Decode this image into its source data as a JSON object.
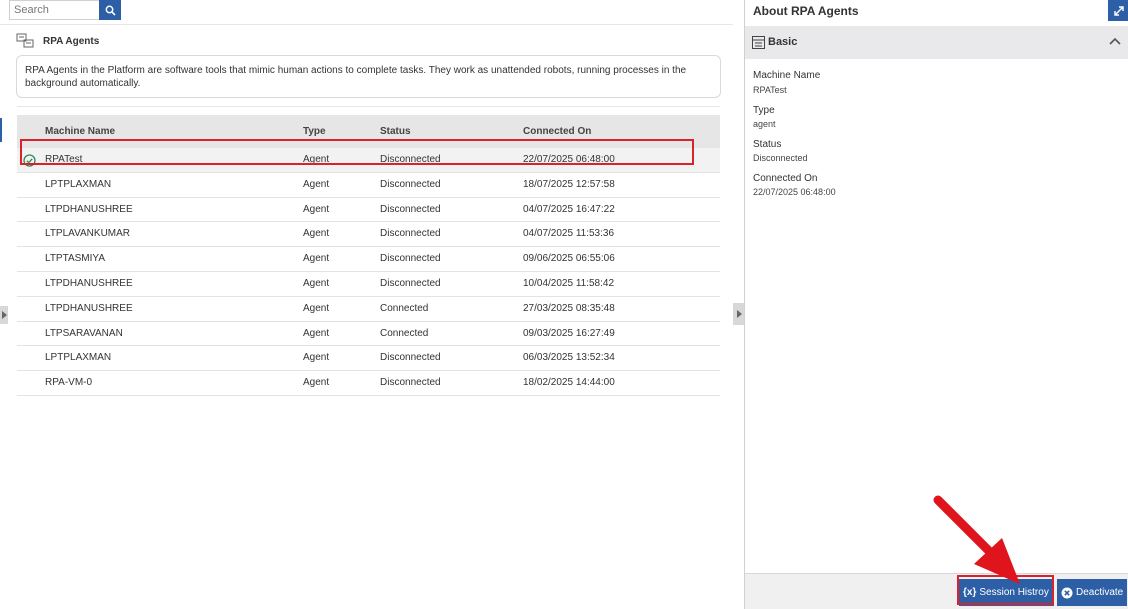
{
  "search": {
    "placeholder": "Search"
  },
  "section": {
    "title": "RPA Agents"
  },
  "description": "RPA Agents in the Platform are software tools that mimic human actions to complete tasks. They work as unattended robots, running processes in the background automatically.",
  "table": {
    "columns": [
      "Machine Name",
      "Type",
      "Status",
      "Connected On"
    ],
    "rows": [
      {
        "name": "RPATest",
        "type": "Agent",
        "status": "Disconnected",
        "connected_on": "22/07/2025 06:48:00"
      },
      {
        "name": "LPTPLAXMAN",
        "type": "Agent",
        "status": "Disconnected",
        "connected_on": "18/07/2025 12:57:58"
      },
      {
        "name": "LTPDHANUSHREE",
        "type": "Agent",
        "status": "Disconnected",
        "connected_on": "04/07/2025 16:47:22"
      },
      {
        "name": "LTPLAVANKUMAR",
        "type": "Agent",
        "status": "Disconnected",
        "connected_on": "04/07/2025 11:53:36"
      },
      {
        "name": "LTPTASMIYA",
        "type": "Agent",
        "status": "Disconnected",
        "connected_on": "09/06/2025 06:55:06"
      },
      {
        "name": "LTPDHANUSHREE",
        "type": "Agent",
        "status": "Disconnected",
        "connected_on": "10/04/2025 11:58:42"
      },
      {
        "name": "LTPDHANUSHREE",
        "type": "Agent",
        "status": "Connected",
        "connected_on": "27/03/2025 08:35:48"
      },
      {
        "name": "LTPSARAVANAN",
        "type": "Agent",
        "status": "Connected",
        "connected_on": "09/03/2025 16:27:49"
      },
      {
        "name": "LPTPLAXMAN",
        "type": "Agent",
        "status": "Disconnected",
        "connected_on": "06/03/2025 13:52:34"
      },
      {
        "name": "RPA-VM-0",
        "type": "Agent",
        "status": "Disconnected",
        "connected_on": "18/02/2025 14:44:00"
      }
    ]
  },
  "details": {
    "title": "About RPA Agents",
    "section": "Basic",
    "fields": [
      {
        "label": "Machine Name",
        "value": "RPATest"
      },
      {
        "label": "Type",
        "value": "agent"
      },
      {
        "label": "Status",
        "value": "Disconnected"
      },
      {
        "label": "Connected On",
        "value": "22/07/2025 06:48:00"
      }
    ]
  },
  "footer": {
    "session_icon": "{x}",
    "session_label": "Session Histroy",
    "deactivate_label": "Deactivate"
  },
  "colors": {
    "accent": "#2d5fa6",
    "highlight": "#d9222a",
    "success": "#2e8b57"
  },
  "icons": [
    "search-icon",
    "rpa-agents-icon",
    "check-circle-icon",
    "expand-icon",
    "form-icon",
    "chevron-up-icon",
    "close-circle-icon",
    "collapse-handle-icon"
  ]
}
